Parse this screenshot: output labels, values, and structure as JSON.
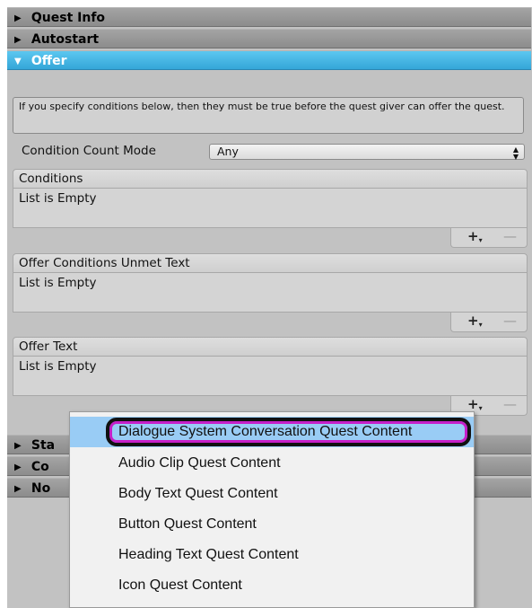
{
  "foldouts": {
    "quest_info": "Quest Info",
    "autostart": "Autostart",
    "offer": "Offer",
    "states_partial": "Sta",
    "content_partial": "Co",
    "nodes_partial": "No"
  },
  "icons": {
    "collapsed": "▶",
    "expanded": "▼",
    "updown": "▲▼"
  },
  "offer": {
    "help_text": "If you specify conditions below, then they must be true before the quest giver can offer the quest.",
    "condition_count_mode_label": "Condition Count Mode",
    "condition_count_mode_value": "Any"
  },
  "lists": [
    {
      "header": "Conditions",
      "body": "List is Empty"
    },
    {
      "header": "Offer Conditions Unmet Text",
      "body": "List is Empty"
    },
    {
      "header": "Offer Text",
      "body": "List is Empty"
    }
  ],
  "list_buttons": {
    "add": "+",
    "remove": "—"
  },
  "menu": {
    "items": [
      "Dialogue System Conversation Quest Content",
      "Audio Clip Quest Content",
      "Body Text Quest Content",
      "Button Quest Content",
      "Heading Text Quest Content",
      "Icon Quest Content"
    ]
  },
  "colors": {
    "accent": "#3cb0e2",
    "highlight": "#c61fc9",
    "selection": "#99ccf5"
  }
}
